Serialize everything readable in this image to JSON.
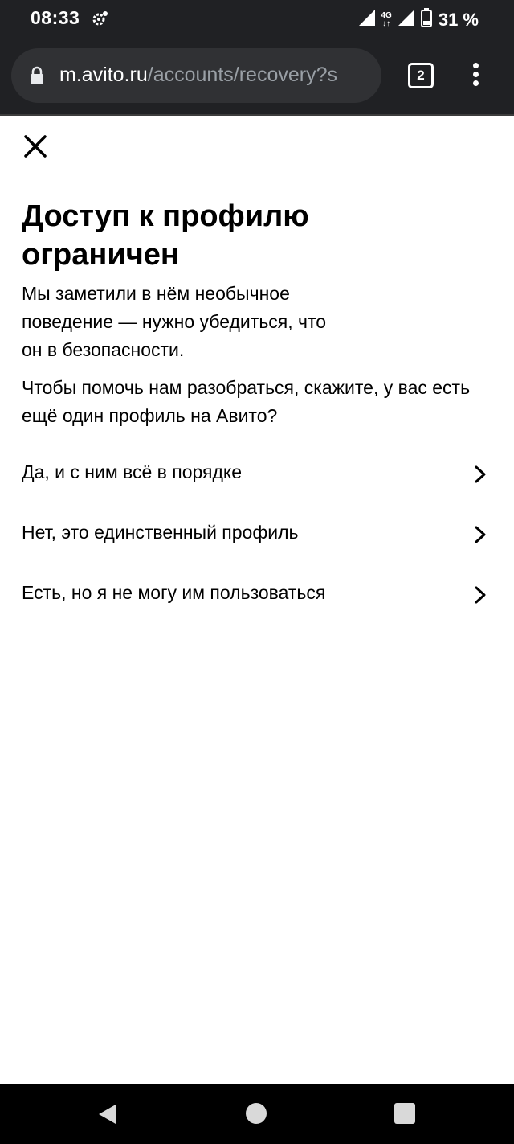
{
  "statusbar": {
    "time": "08:33",
    "network": "4G",
    "battery": "31 %"
  },
  "browser": {
    "url_host": "m.avito.ru",
    "url_path": "/accounts/recovery?s",
    "tab_count": "2"
  },
  "page": {
    "title": "Доступ к профилю ограничен",
    "description": "Мы заметили в нём необычное поведение — нужно убедиться, что он в безопасности.",
    "question": "Чтобы помочь нам разобраться, скажите, у вас есть ещё один профиль на Авито?",
    "options": [
      {
        "label": "Да, и с ним всё в порядке"
      },
      {
        "label": "Нет, это единственный профиль"
      },
      {
        "label": "Есть, но я не могу им пользоваться"
      }
    ]
  },
  "icons": {
    "close": "close-icon",
    "chevron": "chevron-right-icon",
    "lock": "lock-icon"
  }
}
